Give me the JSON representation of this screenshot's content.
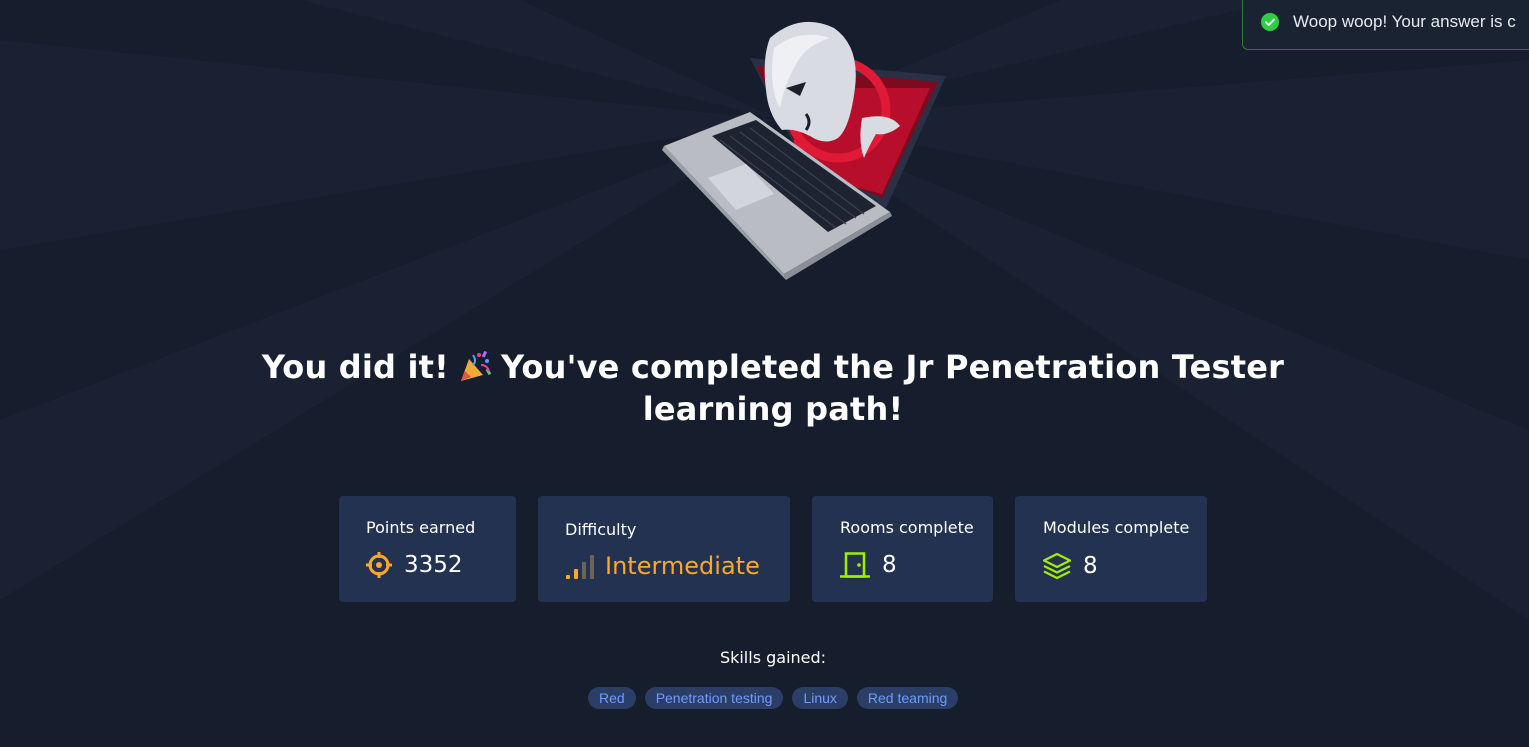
{
  "toast": {
    "message": "Woop woop! Your answer is c",
    "icon": "check-circle-icon",
    "color": "#2fcc45"
  },
  "headline": {
    "part1": "You did it!",
    "part2": "You've completed the Jr Penetration Tester learning path!",
    "emoji_icon": "party-popper-icon"
  },
  "stats": {
    "points": {
      "label": "Points earned",
      "value": "3352",
      "icon": "crosshair-icon",
      "color": "#ffa72b"
    },
    "difficulty": {
      "label": "Difficulty",
      "value": "Intermediate",
      "icon": "signal-bars-icon",
      "color": "#ffa72b"
    },
    "rooms": {
      "label": "Rooms complete",
      "value": "8",
      "icon": "door-icon",
      "color": "#9fef00"
    },
    "modules": {
      "label": "Modules complete",
      "value": "8",
      "icon": "layers-icon",
      "color": "#9fef00"
    }
  },
  "skills": {
    "title": "Skills gained:",
    "tags": [
      "Red",
      "Penetration testing",
      "Linux",
      "Red teaming"
    ]
  },
  "colors": {
    "background": "#161d2c",
    "card": "#223250",
    "tag_bg": "#2a3e66",
    "tag_text": "#6e9cff"
  }
}
